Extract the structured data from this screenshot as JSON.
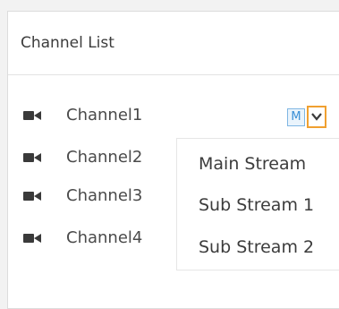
{
  "panel": {
    "title": "Channel List"
  },
  "channels": [
    {
      "label": "Channel1",
      "icon": "camera-icon"
    },
    {
      "label": "Channel2",
      "icon": "camera-icon"
    },
    {
      "label": "Channel3",
      "icon": "camera-icon"
    },
    {
      "label": "Channel4",
      "icon": "camera-icon"
    }
  ],
  "stream_selector": {
    "current_badge": "M",
    "toggle_icon": "chevron-down-icon"
  },
  "stream_menu": {
    "options": [
      "Main Stream",
      "Sub Stream 1",
      "Sub Stream 2"
    ]
  },
  "colors": {
    "accent_orange": "#f0a030",
    "badge_blue": "#3a8fd6",
    "icon_dark": "#3a3a3a"
  }
}
